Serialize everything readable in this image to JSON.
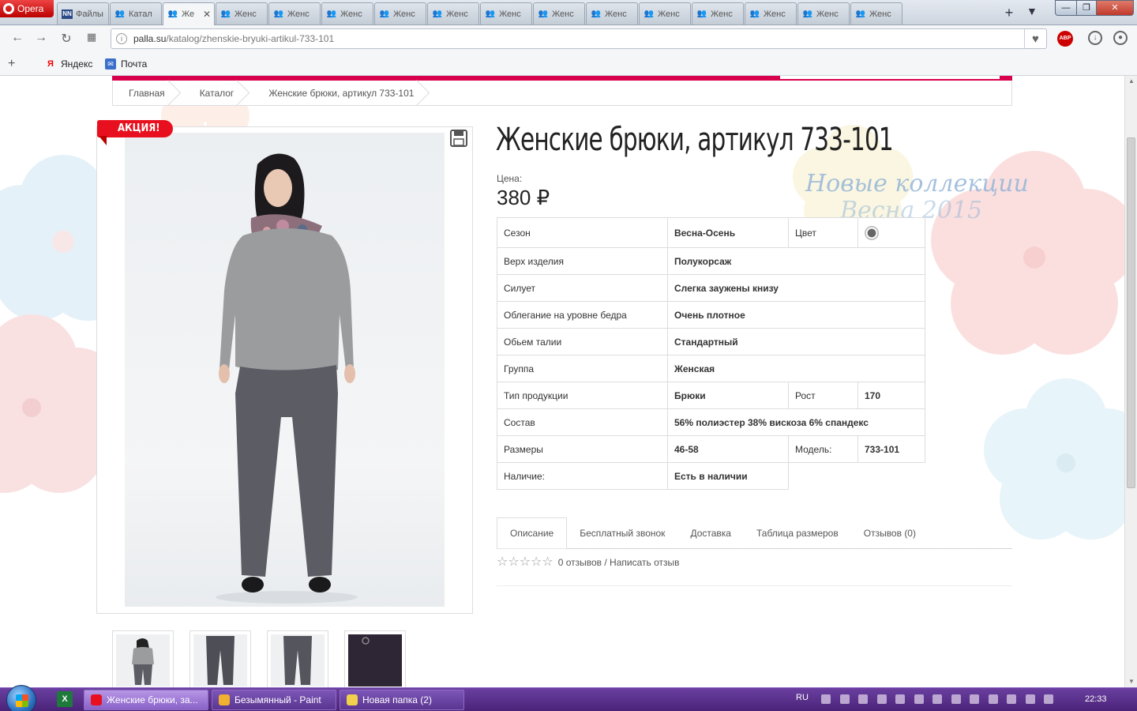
{
  "browser": {
    "menu_label": "Opera",
    "tabs": [
      {
        "label": "Файлы",
        "icon": "nn-icon",
        "active": false
      },
      {
        "label": "Катал",
        "icon": "palla-icon",
        "active": false
      },
      {
        "label": "Же",
        "icon": "palla-icon",
        "active": true
      },
      {
        "label": "Женс",
        "icon": "palla-icon",
        "active": false
      },
      {
        "label": "Женс",
        "icon": "palla-icon",
        "active": false
      },
      {
        "label": "Женс",
        "icon": "palla-icon",
        "active": false
      },
      {
        "label": "Женс",
        "icon": "palla-icon",
        "active": false
      },
      {
        "label": "Женс",
        "icon": "palla-icon",
        "active": false
      },
      {
        "label": "Женс",
        "icon": "palla-icon",
        "active": false
      },
      {
        "label": "Женс",
        "icon": "palla-icon",
        "active": false
      },
      {
        "label": "Женс",
        "icon": "palla-icon",
        "active": false
      },
      {
        "label": "Женс",
        "icon": "palla-icon",
        "active": false
      },
      {
        "label": "Женс",
        "icon": "palla-icon",
        "active": false
      },
      {
        "label": "Женс",
        "icon": "palla-icon",
        "active": false
      },
      {
        "label": "Женс",
        "icon": "palla-icon",
        "active": false
      },
      {
        "label": "Женс",
        "icon": "palla-icon",
        "active": false
      }
    ],
    "url_host": "palla.su",
    "url_path": "/katalog/zhenskie-bryuki-artikul-733-101",
    "abp_label": "ABP",
    "bookmarks": [
      {
        "label": "Яндекс",
        "icon": "yandex-icon"
      },
      {
        "label": "Почта",
        "icon": "mail-icon"
      }
    ]
  },
  "page": {
    "breadcrumb": [
      "Главная",
      "Каталог",
      "Женские брюки, артикул 733-101"
    ],
    "sale_badge": "АКЦИЯ!",
    "title": "Женские брюки, артикул 733-101",
    "price_label": "Цена:",
    "price": "380 ₽",
    "collection_line1": "Новые коллекции",
    "collection_line2": "Весна 2015",
    "specs": {
      "season_key": "Сезон",
      "season_val": "Весна-Осень",
      "color_key": "Цвет",
      "top_key": "Верх изделия",
      "top_val": "Полукорсаж",
      "silhouette_key": "Силует",
      "silhouette_val": "Слегка заужены книзу",
      "hip_key": "Облегание на уровне бедра",
      "hip_val": "Очень плотное",
      "waist_key": "Обьем талии",
      "waist_val": "Стандартный",
      "group_key": "Группа",
      "group_val": "Женская",
      "type_key": "Тип продукции",
      "type_val": "Брюки",
      "height_key": "Рост",
      "height_val": "170",
      "composition_key": "Состав",
      "composition_val": "56% полиэстер 38% вискоза 6% спандекс",
      "sizes_key": "Размеры",
      "sizes_val": "46-58",
      "model_key": "Модель:",
      "model_val": "733-101",
      "availability_key": "Наличие:",
      "availability_val": "Есть в наличии"
    },
    "product_tabs": [
      "Описание",
      "Бесплатный звонок",
      "Доставка",
      "Таблица размеров",
      "Отзывов (0)"
    ],
    "rating_text": "0 отзывов / Написать отзыв",
    "rating_stars": 0
  },
  "taskbar": {
    "tasks": [
      {
        "label": "Женские брюки, за...",
        "active": true,
        "color": "#e8101e"
      },
      {
        "label": "Безымянный - Paint",
        "active": false,
        "color": "#f0b030"
      },
      {
        "label": "Новая папка (2)",
        "active": false,
        "color": "#f1d04b"
      }
    ],
    "lang": "RU",
    "clock": "22:33"
  },
  "colors": {
    "accent": "#d8004d",
    "sale": "#e8101e",
    "taskbar": "#5a2d8c"
  }
}
